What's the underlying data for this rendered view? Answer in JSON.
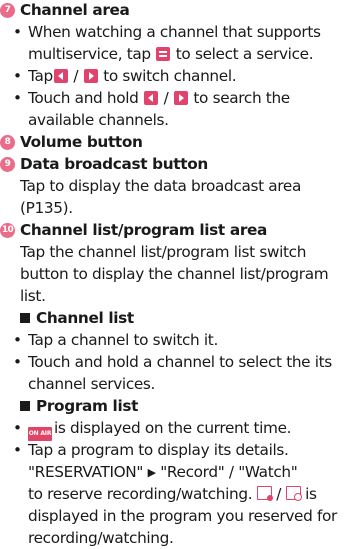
{
  "s7": {
    "num": "7",
    "title": "Channel area",
    "b1a": "When watching a channel that supports",
    "b1b_pre": "multiservice, tap",
    "b1b_post": "to select a service.",
    "b2_pre": "Tap",
    "b2_sep": "/",
    "b2_post": "to switch channel.",
    "b3_pre": "Touch and hold",
    "b3_sep": "/",
    "b3_post": "to search the",
    "b3b": "available channels."
  },
  "s8": {
    "num": "8",
    "title": "Volume button"
  },
  "s9": {
    "num": "9",
    "title": "Data broadcast button",
    "l1": "Tap to display the data broadcast area",
    "l2": "(P135)."
  },
  "s10": {
    "num": "10",
    "title": "Channel list/program list area",
    "l1": "Tap the channel list/program list switch",
    "l2": "button to display the channel list/program",
    "l3": "list.",
    "ch_title": "Channel list",
    "ch_b1": "Tap a channel to switch it.",
    "ch_b2a": "Touch and hold a channel to select the its",
    "ch_b2b": "channel services.",
    "pg_title": "Program list",
    "onair_icon_text": "ON AIR",
    "pg_b1_post": "is displayed on the current time.",
    "pg_b2a": "Tap a program to display its details.",
    "pg_b2b_pre": "\"RESERVATION\"",
    "pg_b2b_arrow": "▶",
    "pg_b2b_post": "\"Record\" / \"Watch\"",
    "pg_b2c_pre": "to reserve recording/watching.",
    "pg_b2c_sep": "/",
    "pg_b2c_post": "is",
    "pg_b2d": "displayed in the program you reserved for",
    "pg_b2e": "recording/watching."
  },
  "bullet": "•",
  "colors": {
    "accent": "#e0436b",
    "badge": "#ea6c8a",
    "text": "#1a1a1a"
  }
}
